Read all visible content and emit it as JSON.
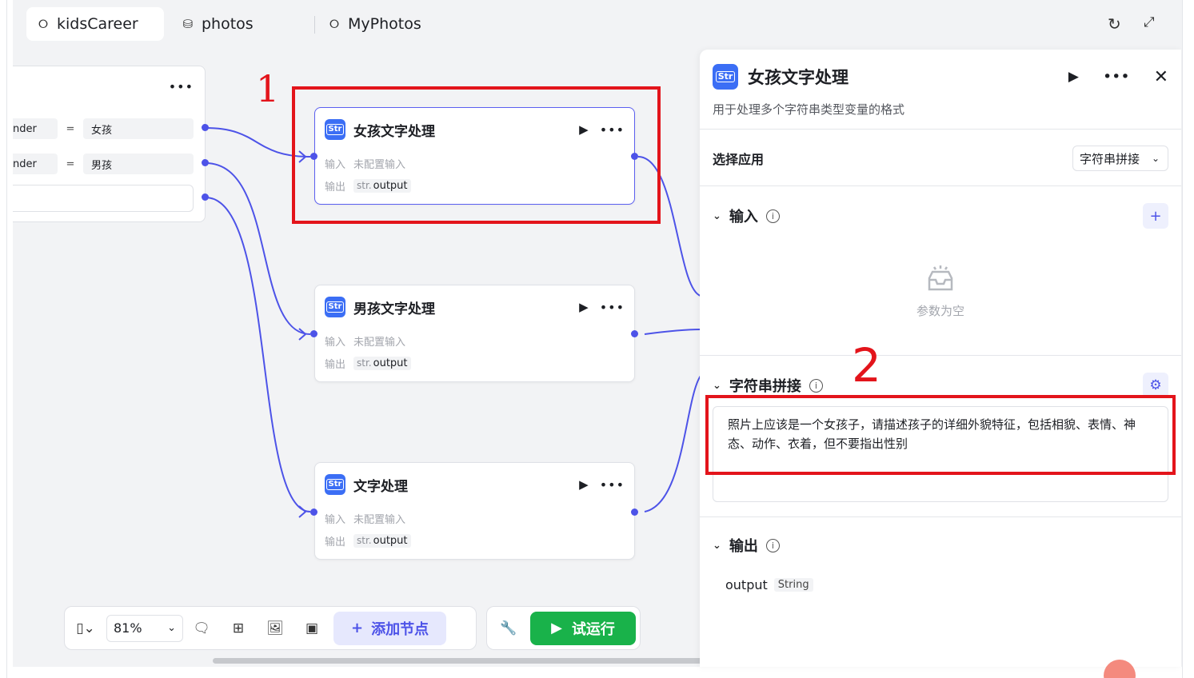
{
  "tabs": [
    {
      "label": "kidsCareer",
      "icon": "workflow-icon",
      "active": true
    },
    {
      "label": "photos",
      "icon": "database-icon",
      "active": false
    },
    {
      "label": "MyPhotos",
      "icon": "workflow-icon",
      "active": false
    }
  ],
  "condition_node": {
    "rows": [
      {
        "field": "nder",
        "op": "=",
        "value": "女孩"
      },
      {
        "field": "nder",
        "op": "=",
        "value": "男孩"
      }
    ]
  },
  "nodes": [
    {
      "title": "女孩文字处理",
      "input_label": "输入",
      "input_value": "未配置输入",
      "output_label": "输出",
      "output_type": "str.",
      "output_name": "output"
    },
    {
      "title": "男孩文字处理",
      "input_label": "输入",
      "input_value": "未配置输入",
      "output_label": "输出",
      "output_type": "str.",
      "output_name": "output"
    },
    {
      "title": "文字处理",
      "input_label": "输入",
      "input_value": "未配置输入",
      "output_label": "输出",
      "output_type": "str.",
      "output_name": "output"
    }
  ],
  "node_icon_text": "Str",
  "toolbar": {
    "zoom": "81%",
    "add_node": "添加节点",
    "run": "试运行"
  },
  "panel": {
    "title": "女孩文字处理",
    "description": "用于处理多个字符串类型变量的格式",
    "select_app_label": "选择应用",
    "select_app_value": "字符串拼接",
    "input_section": "输入",
    "empty_text": "参数为空",
    "concat_section": "字符串拼接",
    "concat_text": "照片上应该是一个女孩子，请描述孩子的详细外貌特征，包括相貌、表情、神态、动作、衣着，但不要指出性别",
    "output_section": "输出",
    "output_name": "output",
    "output_type": "String"
  },
  "annotations": {
    "mark1": "1",
    "mark2": "2"
  },
  "colors": {
    "accent": "#4d53e8",
    "run_green": "#19b24a",
    "annotation_red": "#e3141b",
    "node_icon": "#3b6ef5"
  }
}
